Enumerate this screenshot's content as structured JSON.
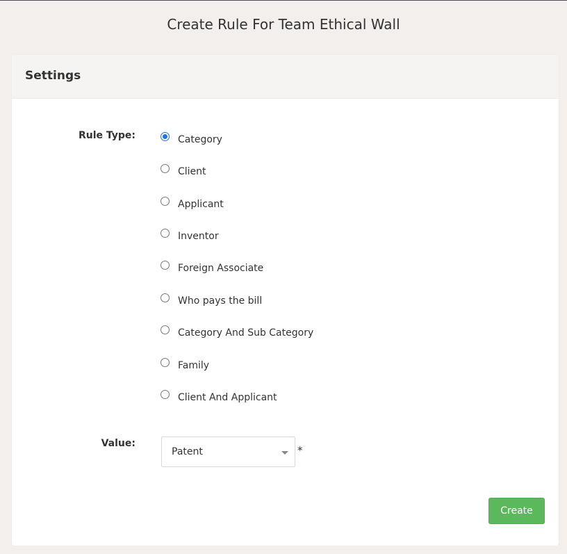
{
  "page": {
    "title": "Create Rule For Team Ethical Wall"
  },
  "panel": {
    "title": "Settings"
  },
  "rule_type": {
    "label": "Rule Type:",
    "selected": "Category",
    "options": [
      "Category",
      "Client",
      "Applicant",
      "Inventor",
      "Foreign Associate",
      "Who pays the bill",
      "Category And Sub Category",
      "Family",
      "Client And Applicant"
    ]
  },
  "value": {
    "label": "Value:",
    "selected": "Patent",
    "required_mark": "*"
  },
  "actions": {
    "create_label": "Create"
  },
  "colors": {
    "background": "#f2efec",
    "create_button": "#5cb85c",
    "radio_checked": "#1a73e8"
  },
  "icons": {
    "select_arrow": "chevron-down-icon"
  }
}
